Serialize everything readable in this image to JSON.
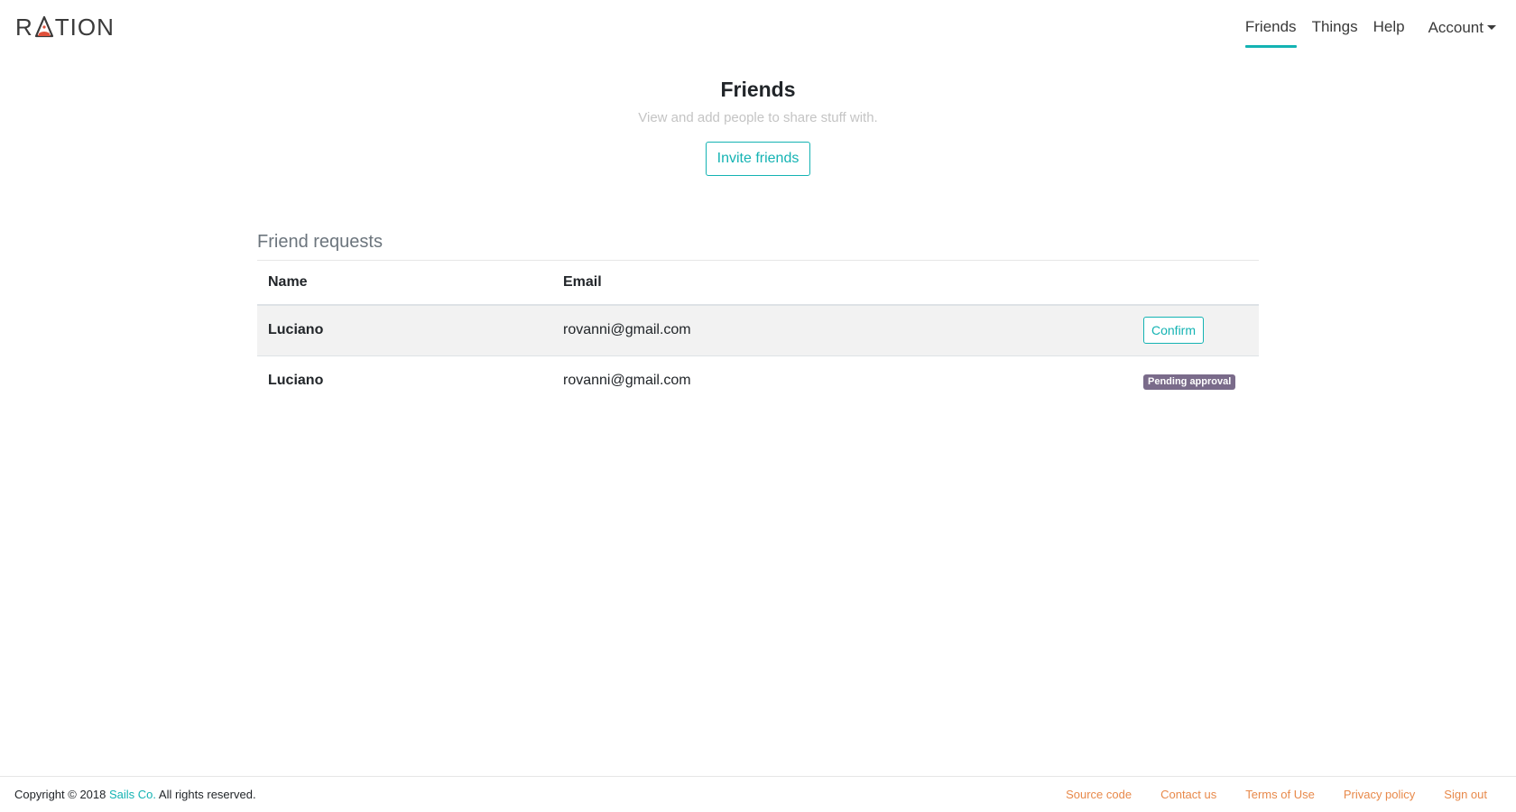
{
  "header": {
    "logo_left": "R",
    "logo_right": "TION",
    "nav": {
      "friends": "Friends",
      "things": "Things",
      "help": "Help",
      "account": "Account"
    },
    "accent_color": "#14b3b3"
  },
  "hero": {
    "title": "Friends",
    "subtitle": "View and add people to share stuff with.",
    "invite_label": "Invite friends"
  },
  "requests": {
    "heading": "Friend requests",
    "columns": [
      "Name",
      "Email",
      ""
    ],
    "rows": [
      {
        "name": "Luciano",
        "email": "rovanni@gmail.com",
        "action": "Confirm"
      },
      {
        "name": "Luciano",
        "email": "rovanni@gmail.com",
        "status": "Pending approval"
      }
    ]
  },
  "footer": {
    "copyright_prefix": "Copyright © 2018 ",
    "brand": "Sails Co.",
    "copyright_suffix": " All rights reserved.",
    "links": [
      "Source code",
      "Contact us",
      "Terms of Use",
      "Privacy policy",
      "Sign out"
    ],
    "link_color": "#e8894a"
  }
}
